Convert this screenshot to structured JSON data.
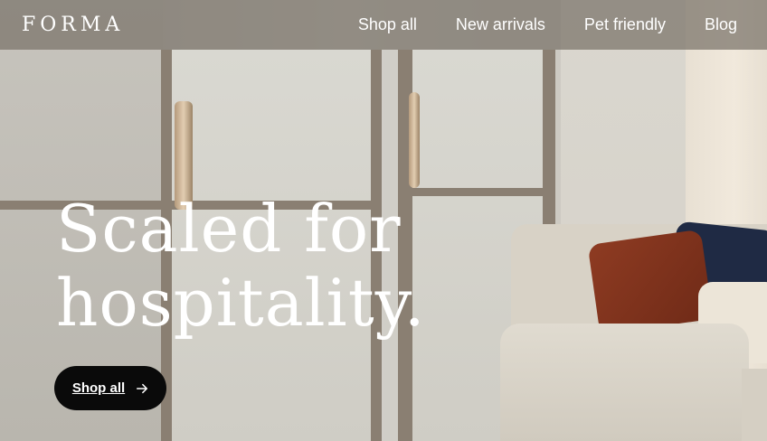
{
  "brand": {
    "logo": "FORMA"
  },
  "nav": {
    "items": [
      {
        "label": "Shop all"
      },
      {
        "label": "New arrivals"
      },
      {
        "label": "Pet friendly"
      },
      {
        "label": "Blog"
      }
    ]
  },
  "hero": {
    "headline_line1": "Scaled for",
    "headline_line2": "hospitality.",
    "cta_label": "Shop all",
    "cta_icon": "arrow-right-icon"
  },
  "colors": {
    "nav_background": "#787268",
    "cta_background": "#0a0a0a",
    "text": "#ffffff"
  }
}
